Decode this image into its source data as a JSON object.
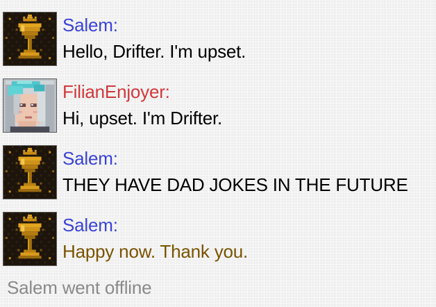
{
  "colors": {
    "salem_name": "#3a43d6",
    "filian_name": "#d1393c",
    "message_text": "#000000",
    "gold_message_text": "#7a5300",
    "status_text": "#8a8a8a"
  },
  "messages": [
    {
      "sender": "Salem:",
      "text": "Hello, Drifter. I'm upset.",
      "avatar_icon": "golden-chalice-icon"
    },
    {
      "sender": "FilianEnjoyer:",
      "text": "Hi, upset. I'm Drifter.",
      "avatar_icon": "silver-haired-girl-portrait-icon"
    },
    {
      "sender": "Salem:",
      "text": "THEY HAVE DAD JOKES IN THE FUTURE",
      "avatar_icon": "golden-chalice-icon"
    },
    {
      "sender": "Salem:",
      "text": "Happy now. Thank you.",
      "avatar_icon": "golden-chalice-icon"
    }
  ],
  "status": "Salem went offline"
}
